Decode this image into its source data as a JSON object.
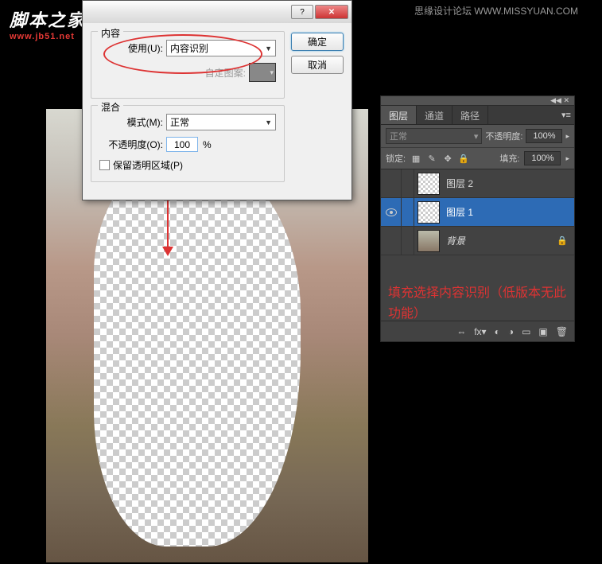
{
  "watermark": {
    "cn": "脚本之家",
    "url": "www.jb51.net",
    "top": "思缘设计论坛 WWW.MISSYUAN.COM"
  },
  "dialog": {
    "content_legend": "内容",
    "use_label": "使用(U):",
    "use_value": "内容识别",
    "pattern_label": "自定图案:",
    "blend_legend": "混合",
    "mode_label": "模式(M):",
    "mode_value": "正常",
    "opacity_label": "不透明度(O):",
    "opacity_value": "100",
    "opacity_suffix": "%",
    "preserve_label": "保留透明区域(P)",
    "ok": "确定",
    "cancel": "取消"
  },
  "layers": {
    "tabs": {
      "layers": "图层",
      "channels": "通道",
      "paths": "路径"
    },
    "blend_mode": "正常",
    "opacity_label": "不透明度:",
    "opacity_value": "100%",
    "lock_label": "锁定:",
    "fill_label": "填充:",
    "fill_value": "100%",
    "items": [
      {
        "name": "图层 2",
        "visible": false,
        "selected": false,
        "locked": false,
        "bg": false
      },
      {
        "name": "图层 1",
        "visible": true,
        "selected": true,
        "locked": false,
        "bg": false
      },
      {
        "name": "背景",
        "visible": false,
        "selected": false,
        "locked": true,
        "bg": true
      }
    ]
  },
  "annotation": "填充选择内容识别（低版本无此功能）"
}
